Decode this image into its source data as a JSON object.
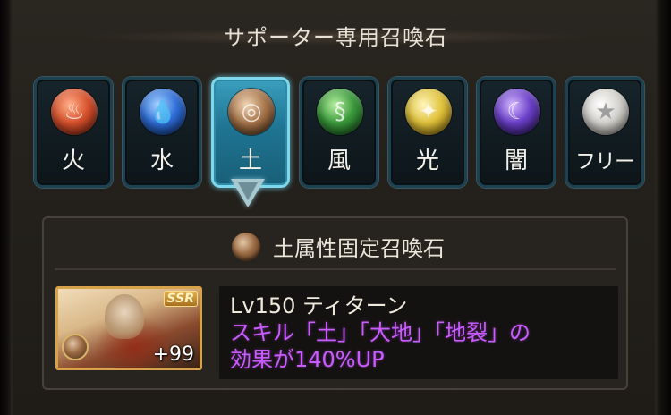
{
  "section_title": "サポーター専用召喚石",
  "tabs": [
    {
      "label": "火",
      "icon": "fire-element-icon",
      "color": "#c8452a",
      "selected": false
    },
    {
      "label": "水",
      "icon": "water-element-icon",
      "color": "#2f6fd8",
      "selected": false
    },
    {
      "label": "土",
      "icon": "earth-element-icon",
      "color": "#9b6b44",
      "selected": true
    },
    {
      "label": "風",
      "icon": "wind-element-icon",
      "color": "#3b9a3c",
      "selected": false
    },
    {
      "label": "光",
      "icon": "light-element-icon",
      "color": "#e0c23a",
      "selected": false
    },
    {
      "label": "闇",
      "icon": "dark-element-icon",
      "color": "#6a3fc8",
      "selected": false
    },
    {
      "label": "フリー",
      "icon": "free-star-icon",
      "color": "#d4d2cd",
      "selected": false
    }
  ],
  "panel": {
    "title": "土属性固定召喚石",
    "summon": {
      "name": "Lv150 ティターン",
      "rarity": "SSR",
      "plus": "+99",
      "effect_line1": "スキル「土」「大地」「地裂」の",
      "effect_line2": "効果が140%UP"
    }
  },
  "colors": {
    "selected_tab": "#3a9fbd",
    "effect_text": "#c95cff"
  }
}
